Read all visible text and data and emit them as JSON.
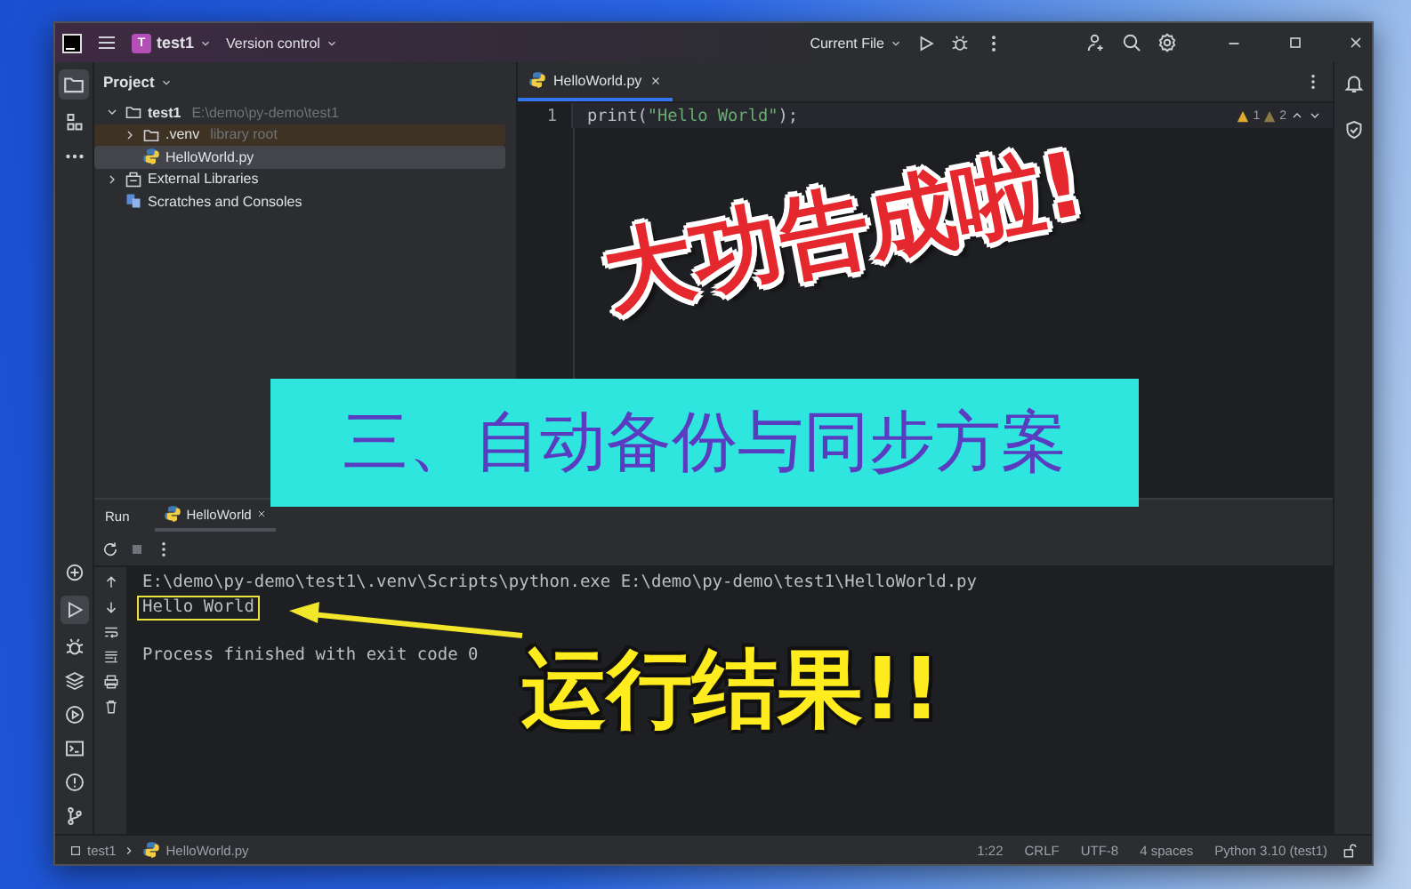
{
  "title_bar": {
    "project_badge": "T",
    "project": "test1",
    "vcs": "Version control",
    "run_config": "Current File"
  },
  "project_panel": {
    "title": "Project",
    "tree": [
      {
        "name": "test1",
        "hint": "E:\\demo\\py-demo\\test1",
        "kind": "folder",
        "expanded": true,
        "selected": false,
        "children": [
          {
            "name": ".venv",
            "hint": "library root",
            "kind": "venv",
            "expanded": false,
            "selected": false
          },
          {
            "name": "HelloWorld.py",
            "kind": "python",
            "selected": true
          }
        ]
      },
      {
        "name": "External Libraries",
        "kind": "library",
        "expanded": false,
        "selected": false
      },
      {
        "name": "Scratches and Consoles",
        "kind": "scratch",
        "selected": false
      }
    ]
  },
  "editor": {
    "tabs": [
      {
        "label": "HelloWorld.py",
        "selected": true
      }
    ],
    "lines": [
      {
        "number": "1",
        "tokens": [
          {
            "text": "print(",
            "kind": "plain"
          },
          {
            "text": "\"Hello World\"",
            "kind": "string"
          },
          {
            "text": ");",
            "kind": "plain"
          }
        ]
      }
    ],
    "inspections": {
      "warnings": "1",
      "weak_warnings": "2"
    }
  },
  "run_panel": {
    "title": "Run",
    "tabs": [
      {
        "label": "HelloWorld",
        "selected": true
      }
    ],
    "output": [
      {
        "text": "E:\\demo\\py-demo\\test1\\.venv\\Scripts\\python.exe E:\\demo\\py-demo\\test1\\HelloWorld.py",
        "kind": "command",
        "boxed": false
      },
      {
        "text": "Hello World",
        "kind": "stdout",
        "boxed": true
      },
      {
        "text": "Process finished with exit code 0",
        "kind": "exit",
        "boxed": false
      }
    ]
  },
  "status_bar": {
    "breadcrumbs": [
      "test1",
      "HelloWorld.py"
    ],
    "items": [
      "1:22",
      "CRLF",
      "UTF-8",
      "4 spaces",
      "Python 3.10 (test1)"
    ]
  },
  "overlays": {
    "headline": "大功告成啦!",
    "banner": "三、自动备份与同步方案",
    "callout": "运行结果!!"
  }
}
